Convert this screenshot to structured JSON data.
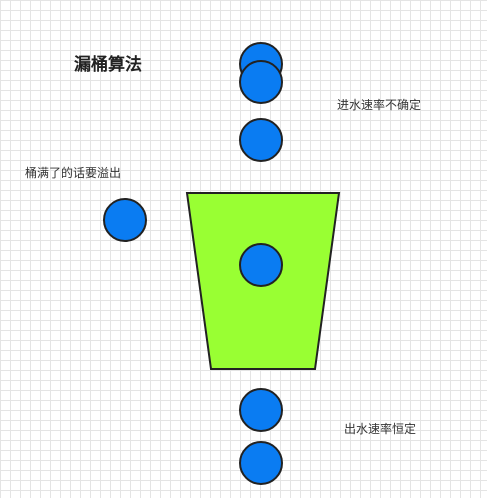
{
  "title": "漏桶算法",
  "labels": {
    "inflow": "进水速率不确定",
    "overflow": "桶满了的话要溢出",
    "outflow": "出水速率恒定"
  },
  "colors": {
    "bucket_fill": "#99ff33",
    "droplet_fill": "#0a7cf2",
    "stroke": "#222222"
  }
}
